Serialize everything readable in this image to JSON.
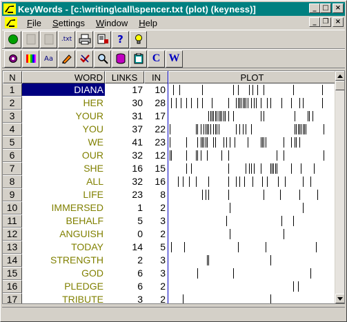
{
  "window": {
    "title": "KeyWords - [c:\\writing\\call\\spencer.txt (plot) (keyness)]"
  },
  "caption_buttons": {
    "minimize": "_",
    "maximize": "□",
    "close": "×"
  },
  "child_buttons": {
    "minimize": "_",
    "restore": "❐",
    "close": "×"
  },
  "menu": [
    {
      "label": "File",
      "u": "F",
      "rest": "ile"
    },
    {
      "label": "Settings",
      "u": "S",
      "rest": "ettings"
    },
    {
      "label": "Window",
      "u": "W",
      "rest": "indow"
    },
    {
      "label": "Help",
      "u": "H",
      "rest": "elp"
    }
  ],
  "toolbar1": {
    "txt_label": ".txt",
    "help_label": "?"
  },
  "toolbar2": {
    "aa_label": "Aa",
    "c_label": "C",
    "w_label": "W"
  },
  "grid": {
    "headers": {
      "n": "N",
      "word": "WORD",
      "links": "LINKS",
      "in": "IN",
      "plot": "PLOT"
    },
    "rows": [
      {
        "n": "1",
        "word": "DIANA",
        "links": "17",
        "in": "10",
        "selected": true,
        "marks": [
          0.02,
          0.06,
          0.2,
          0.39,
          0.42,
          0.49,
          0.51,
          0.54,
          0.58,
          0.76,
          0.94
        ]
      },
      {
        "n": "2",
        "word": "HER",
        "links": "30",
        "in": "28",
        "marks": [
          0.01,
          0.04,
          0.07,
          0.1,
          0.13,
          0.17,
          0.2,
          0.26,
          0.36,
          0.41,
          0.42,
          0.43,
          0.44,
          0.45,
          0.46,
          0.47,
          0.48,
          0.5,
          0.52,
          0.53,
          0.56,
          0.6,
          0.62,
          0.69,
          0.75,
          0.8,
          0.82,
          0.94
        ]
      },
      {
        "n": "3",
        "word": "YOUR",
        "links": "31",
        "in": "17",
        "marks": [
          0.24,
          0.25,
          0.26,
          0.27,
          0.28,
          0.29,
          0.3,
          0.31,
          0.32,
          0.33,
          0.34,
          0.36,
          0.39,
          0.56,
          0.58,
          0.77,
          0.85,
          0.86,
          0.88
        ]
      },
      {
        "n": "4",
        "word": "YOU",
        "links": "37",
        "in": "22",
        "marks": [
          0.0,
          0.17,
          0.16,
          0.19,
          0.21,
          0.22,
          0.23,
          0.24,
          0.25,
          0.27,
          0.28,
          0.29,
          0.3,
          0.41,
          0.43,
          0.45,
          0.47,
          0.5,
          0.77,
          0.78,
          0.79,
          0.8,
          0.81,
          0.82,
          0.83,
          0.84,
          0.95
        ]
      },
      {
        "n": "5",
        "word": "WE",
        "links": "41",
        "in": "23",
        "marks": [
          0.0,
          0.1,
          0.17,
          0.19,
          0.2,
          0.21,
          0.22,
          0.23,
          0.27,
          0.28,
          0.33,
          0.35,
          0.37,
          0.4,
          0.48,
          0.56,
          0.57,
          0.58,
          0.59,
          0.7,
          0.75,
          0.77,
          0.78,
          0.8
        ]
      },
      {
        "n": "6",
        "word": "OUR",
        "links": "32",
        "in": "12",
        "marks": [
          0.0,
          0.01,
          0.1,
          0.16,
          0.17,
          0.19,
          0.23,
          0.32,
          0.36,
          0.66,
          0.7,
          0.95
        ]
      },
      {
        "n": "7",
        "word": "SHE",
        "links": "16",
        "in": "15",
        "marks": [
          0.1,
          0.13,
          0.36,
          0.47,
          0.49,
          0.5,
          0.52,
          0.56,
          0.62,
          0.63,
          0.64,
          0.65,
          0.66,
          0.75,
          0.81,
          0.89
        ]
      },
      {
        "n": "8",
        "word": "ALL",
        "links": "32",
        "in": "16",
        "marks": [
          0.05,
          0.08,
          0.12,
          0.16,
          0.24,
          0.36,
          0.41,
          0.43,
          0.46,
          0.51,
          0.57,
          0.6,
          0.67,
          0.71,
          0.82,
          0.87
        ]
      },
      {
        "n": "9",
        "word": "LIFE",
        "links": "23",
        "in": "8",
        "marks": [
          0.2,
          0.22,
          0.24,
          0.36,
          0.58,
          0.68,
          0.8,
          0.91
        ]
      },
      {
        "n": "10",
        "word": "IMMERSED",
        "links": "1",
        "in": "2",
        "marks": [
          0.37,
          0.82
        ]
      },
      {
        "n": "11",
        "word": "BEHALF",
        "links": "5",
        "in": "3",
        "marks": [
          0.35,
          0.69,
          0.76
        ]
      },
      {
        "n": "12",
        "word": "ANGUISH",
        "links": "0",
        "in": "2",
        "marks": [
          0.37,
          0.7
        ]
      },
      {
        "n": "13",
        "word": "TODAY",
        "links": "14",
        "in": "5",
        "marks": [
          0.01,
          0.09,
          0.42,
          0.59,
          0.9
        ]
      },
      {
        "n": "14",
        "word": "STRENGTH",
        "links": "2",
        "in": "3",
        "marks": [
          0.23,
          0.24,
          0.62
        ]
      },
      {
        "n": "15",
        "word": "GOD",
        "links": "6",
        "in": "3",
        "marks": [
          0.17,
          0.39,
          0.87
        ]
      },
      {
        "n": "16",
        "word": "PLEDGE",
        "links": "6",
        "in": "2",
        "marks": [
          0.76,
          0.79
        ]
      },
      {
        "n": "17",
        "word": "TRIBUTE",
        "links": "3",
        "in": "2",
        "marks": [
          0.08,
          0.62
        ]
      }
    ]
  }
}
